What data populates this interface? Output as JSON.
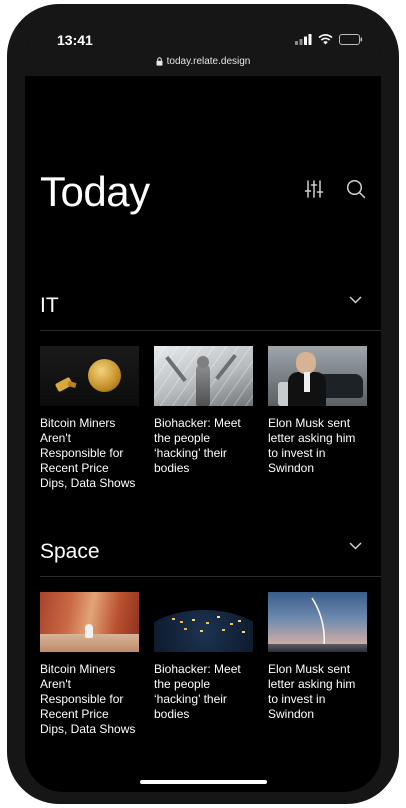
{
  "status_bar": {
    "time": "13:41",
    "url": "today.relate.design"
  },
  "page": {
    "title": "Today"
  },
  "sections": [
    {
      "label": "IT",
      "cards": [
        {
          "title": "Bitcoin Miners Aren't Responsible for Recent Price Dips, Data Shows"
        },
        {
          "title": "Biohacker: Meet the people ‘hacking’ their bodies"
        },
        {
          "title": "Elon Musk sent letter asking him to invest in Swindon"
        }
      ]
    },
    {
      "label": "Space",
      "cards": [
        {
          "title": "Bitcoin Miners Aren't Responsible for Recent Price Dips, Data Shows"
        },
        {
          "title": "Biohacker: Meet the people ‘hacking’ their bodies"
        },
        {
          "title": "Elon Musk sent letter asking him to invest in Swindon"
        }
      ]
    }
  ],
  "icons": {
    "filter": "sliders-icon",
    "search": "search-icon",
    "expand": "chevron-down-icon",
    "lock": "lock-icon",
    "signal": "signal-icon",
    "wifi": "wifi-icon",
    "battery": "battery-icon"
  },
  "colors": {
    "background": "#000000",
    "frame": "#161616",
    "text": "#ffffff",
    "divider": "#2a2a2a"
  }
}
